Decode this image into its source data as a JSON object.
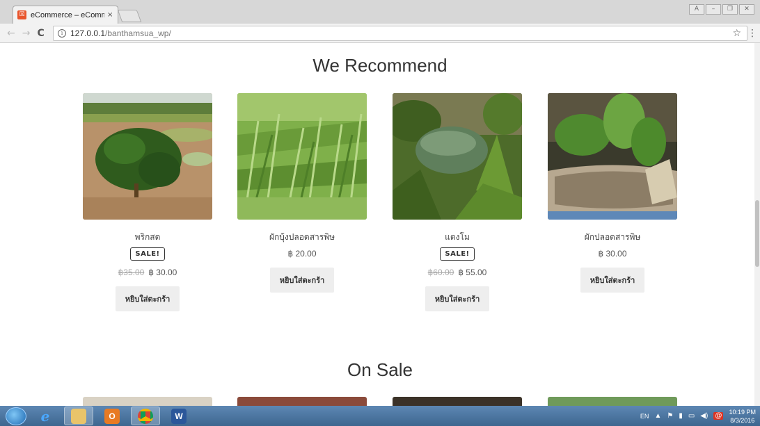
{
  "browser": {
    "tab_title": "eCommerce – eCommerc",
    "tab_close": "×",
    "url_host": "127.0.0.1",
    "url_path": "/banthamsua_wp/",
    "window_buttons": [
      "A",
      "–",
      "❐",
      "✕"
    ]
  },
  "page": {
    "recommend_title": "We Recommend",
    "on_sale_title": "On Sale",
    "products": [
      {
        "name": "พริกสด",
        "badge": "SALE!",
        "old_price": "฿35.00",
        "price": "฿ 30.00",
        "button": "หยิบใส่ตะกร้า",
        "image": "chili-field"
      },
      {
        "name": "ผักบุ้งปลอดสารพิษ",
        "badge": "",
        "old_price": "",
        "price": "฿ 20.00",
        "button": "หยิบใส่ตะกร้า",
        "image": "morning-glory"
      },
      {
        "name": "แตงโม",
        "badge": "SALE!",
        "old_price": "฿60.00",
        "price": "฿ 55.00",
        "button": "หยิบใส่ตะกร้า",
        "image": "watermelon"
      },
      {
        "name": "ผักปลอดสารพิษ",
        "badge": "",
        "old_price": "",
        "price": "฿ 30.00",
        "button": "หยิบใส่ตะกร้า",
        "image": "hanging-greens"
      }
    ]
  },
  "taskbar": {
    "lang": "EN",
    "time": "10:19 PM",
    "date": "8/3/2016",
    "apps": [
      "internet-explorer",
      "file-explorer",
      "outlook",
      "chrome",
      "word"
    ]
  },
  "colors": {
    "badge_border": "#333333",
    "cart_button_bg": "#eeeeee",
    "favicon": "#e8542c"
  }
}
